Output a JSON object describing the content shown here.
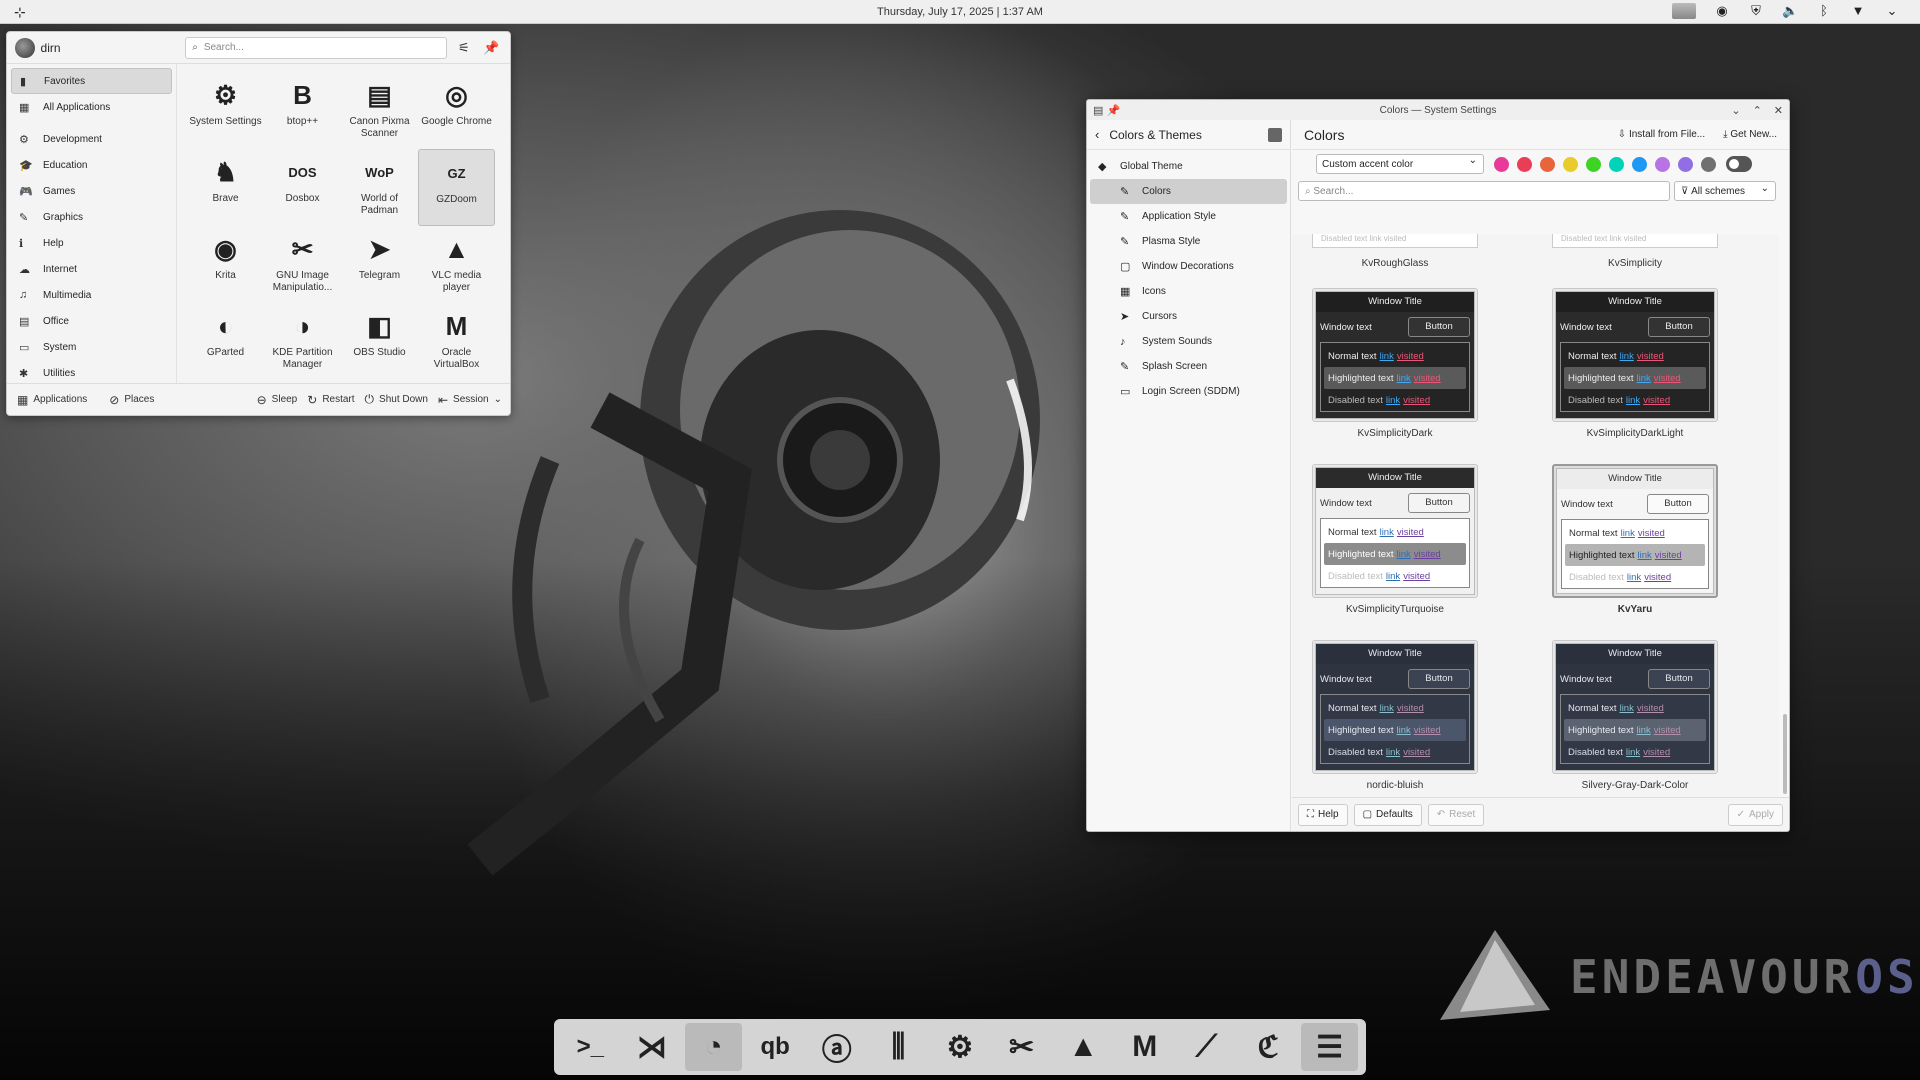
{
  "top_panel": {
    "clock": "Thursday, July 17, 2025 | 1:37 AM",
    "tray_icons": [
      "pager",
      "gamepad-icon",
      "shield-icon",
      "volume-icon",
      "bluetooth-icon",
      "network-icon",
      "chevron-down-icon"
    ]
  },
  "launcher": {
    "user": "dirn",
    "search_placeholder": "Search...",
    "categories": [
      {
        "label": "Favorites",
        "icon": "▮",
        "sel": true
      },
      {
        "label": "All Applications",
        "icon": "▦"
      },
      {
        "gap": true
      },
      {
        "label": "Development",
        "icon": "⚙"
      },
      {
        "label": "Education",
        "icon": "🎓"
      },
      {
        "label": "Games",
        "icon": "🎮"
      },
      {
        "label": "Graphics",
        "icon": "✎"
      },
      {
        "label": "Help",
        "icon": "ℹ"
      },
      {
        "label": "Internet",
        "icon": "☁"
      },
      {
        "label": "Multimedia",
        "icon": "♫"
      },
      {
        "label": "Office",
        "icon": "▤"
      },
      {
        "label": "System",
        "icon": "▭"
      },
      {
        "label": "Utilities",
        "icon": "✱"
      }
    ],
    "apps": [
      {
        "label": "System Settings",
        "icon": "⚙"
      },
      {
        "label": "btop++",
        "icon": "B"
      },
      {
        "label": "Canon Pixma Scanner",
        "icon": "▤"
      },
      {
        "label": "Google Chrome",
        "icon": "◎"
      },
      {
        "label": "Brave",
        "icon": "♞"
      },
      {
        "label": "Dosbox",
        "icon": "DOS"
      },
      {
        "label": "World of Padman",
        "icon": "WoP"
      },
      {
        "label": "GZDoom",
        "icon": "GZ",
        "sel": true
      },
      {
        "label": "Krita",
        "icon": "◉"
      },
      {
        "label": "GNU Image Manipulatio...",
        "icon": "✂"
      },
      {
        "label": "Telegram",
        "icon": "➤"
      },
      {
        "label": "VLC media player",
        "icon": "▲"
      },
      {
        "label": "GParted",
        "icon": "◐"
      },
      {
        "label": "KDE Partition Manager",
        "icon": "◑"
      },
      {
        "label": "OBS Studio",
        "icon": "◧"
      },
      {
        "label": "Oracle VirtualBox",
        "icon": "M"
      }
    ],
    "footer": {
      "applications": "Applications",
      "places": "Places",
      "sleep": "Sleep",
      "restart": "Restart",
      "shutdown": "Shut Down",
      "session": "Session"
    }
  },
  "settings": {
    "window_title": "Colors — System Settings",
    "left_title": "Colors & Themes",
    "nav": [
      {
        "label": "Global Theme",
        "icon": "◆",
        "child": false
      },
      {
        "label": "Colors",
        "icon": "✎",
        "child": true,
        "sel": true
      },
      {
        "label": "Application Style",
        "icon": "✎",
        "child": true
      },
      {
        "label": "Plasma Style",
        "icon": "✎",
        "child": true
      },
      {
        "label": "Window Decorations",
        "icon": "▢",
        "child": true
      },
      {
        "label": "Icons",
        "icon": "▦",
        "child": true
      },
      {
        "label": "Cursors",
        "icon": "➤",
        "child": true
      },
      {
        "label": "System Sounds",
        "icon": "♪",
        "child": true
      },
      {
        "label": "Splash Screen",
        "icon": "✎",
        "child": true
      },
      {
        "label": "Login Screen (SDDM)",
        "icon": "▭",
        "child": true
      }
    ],
    "page_title": "Colors",
    "install_label": "Install from File...",
    "get_new_label": "Get New...",
    "accent_select": "Custom accent color",
    "accent_colors": [
      "#e93a9a",
      "#e93d58",
      "#e9643a",
      "#e8cb2d",
      "#3dd425",
      "#00d3b8",
      "#1d99f3",
      "#b873e5",
      "#926ee4",
      "#707070"
    ],
    "search_placeholder": "Search...",
    "filter": "All schemes",
    "partials": [
      "KvRoughGlass",
      "KvSimplicity"
    ],
    "schemes": [
      {
        "name": "KvSimplicityDark",
        "bg": "#2b2b2b",
        "fg": "#eeeeee",
        "tb": "#1f1f1f",
        "btnbg": "#333",
        "btnfg": "#eee",
        "hl": "#5a5a5a",
        "link": "#3fa9f5",
        "visited": "#e95778",
        "inner": "#242424",
        "dis": "#bbbbbb"
      },
      {
        "name": "KvSimplicityDarkLight",
        "bg": "#2b2b2b",
        "fg": "#eeeeee",
        "tb": "#1f1f1f",
        "btnbg": "#333",
        "btnfg": "#eee",
        "hl": "#5a5a5a",
        "link": "#3fa9f5",
        "visited": "#e95778",
        "inner": "#242424",
        "dis": "#bbbbbb"
      },
      {
        "name": "KvSimplicityTurquoise",
        "bg": "#f0f0f0",
        "fg": "#333333",
        "tb": "#2b2b2b",
        "tbfg": "#eeeeee",
        "btnbg": "#f4f4f4",
        "btnfg": "#333",
        "hl": "#8c8c8c",
        "hlfg": "#ffffff",
        "link": "#2c6fb5",
        "visited": "#6b3fa0",
        "inner": "#ffffff",
        "dis": "#bbbbbb"
      },
      {
        "name": "KvYaru",
        "bg": "#f5f5f5",
        "fg": "#333333",
        "tb": "#ececec",
        "btnbg": "#fafafa",
        "btnfg": "#333",
        "hl": "#b4b4b4",
        "hlfg": "#222",
        "link": "#2c6fb5",
        "visited": "#6b3fa0",
        "inner": "#ffffff",
        "dis": "#bbbbbb",
        "current": true
      },
      {
        "name": "nordic-bluish",
        "bg": "#2e3440",
        "fg": "#e5e9f0",
        "tb": "#2a303c",
        "btnbg": "#3b4252",
        "btnfg": "#e5e9f0",
        "hl": "#4c566a",
        "link": "#88c0d0",
        "visited": "#b48ead",
        "inner": "#323846",
        "dis": "#d8dee9"
      },
      {
        "name": "Silvery-Gray-Dark-Color",
        "bg": "#2e3440",
        "fg": "#e5e9f0",
        "tb": "#2a303c",
        "btnbg": "#3b4252",
        "btnfg": "#e5e9f0",
        "hl": "#5c6370",
        "link": "#88c0d0",
        "visited": "#b48ead",
        "inner": "#323846",
        "dis": "#d8dee9"
      }
    ],
    "preview": {
      "window_title": "Window Title",
      "window_text": "Window text",
      "button": "Button",
      "normal": "Normal text",
      "highlighted": "Highlighted text",
      "disabled": "Disabled text",
      "link": "link",
      "visited": "visited"
    },
    "footer": {
      "help": "Help",
      "defaults": "Defaults",
      "reset": "Reset",
      "apply": "Apply"
    }
  },
  "dock": {
    "items": [
      {
        "name": "terminal-icon",
        "glyph": ">_"
      },
      {
        "name": "vscode-icon",
        "glyph": "⋊"
      },
      {
        "name": "app-icon",
        "glyph": "◔",
        "active": true
      },
      {
        "name": "qbittorrent-icon",
        "glyph": "qb"
      },
      {
        "name": "a-icon",
        "glyph": "ⓐ"
      },
      {
        "name": "mixer-icon",
        "glyph": "⫼"
      },
      {
        "name": "steam-icon",
        "glyph": "⚙"
      },
      {
        "name": "gimp-icon",
        "glyph": "✂"
      },
      {
        "name": "inkscape-icon",
        "glyph": "▲"
      },
      {
        "name": "virtualbox-icon",
        "glyph": "M"
      },
      {
        "name": "krita-icon",
        "glyph": "⟋"
      },
      {
        "name": "typora-icon",
        "glyph": "ℭ"
      },
      {
        "name": "settings-icon",
        "glyph": "☰",
        "active": true
      }
    ]
  },
  "wallpaper_logo": {
    "text1": "ENDEAVOUR",
    "text2": "OS"
  }
}
